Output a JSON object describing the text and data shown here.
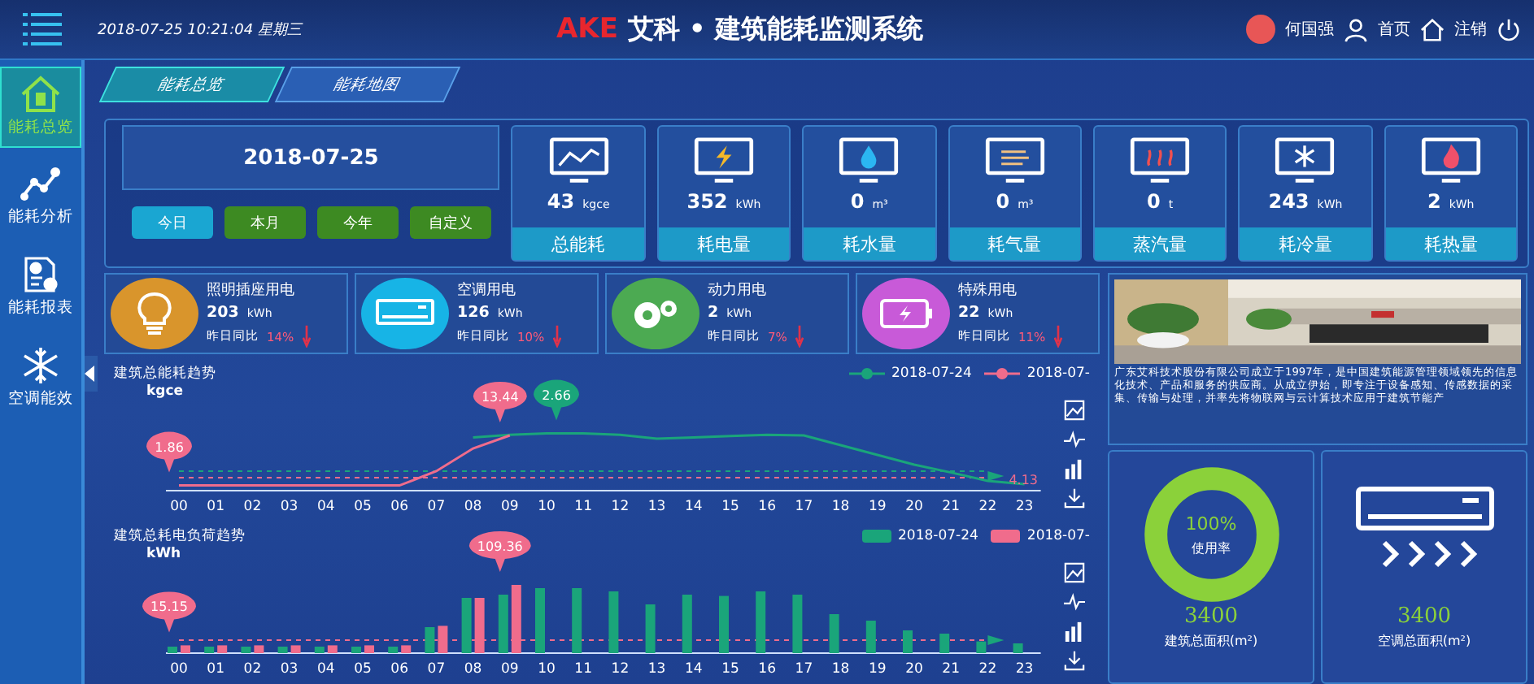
{
  "header": {
    "datetime": "2018-07-25 10:21:04 星期三",
    "logo": "AKE",
    "title": "艾科 • 建筑能耗监测系统",
    "user": "何国强",
    "home": "首页",
    "logout": "注销"
  },
  "tabs": [
    {
      "label": "能耗总览",
      "selected": true
    },
    {
      "label": "能耗地图",
      "selected": false
    }
  ],
  "sidebar": {
    "items": [
      {
        "kind": "house",
        "label": "能耗总览",
        "selected": true
      },
      {
        "kind": "graph",
        "label": "能耗分析",
        "selected": false
      },
      {
        "kind": "report",
        "label": "能耗报表",
        "selected": false
      },
      {
        "kind": "snow",
        "label": "空调能效",
        "selected": false
      }
    ]
  },
  "date_panel": {
    "date": "2018-07-25",
    "periods": [
      {
        "label": "今日",
        "selected": true
      },
      {
        "label": "本月",
        "selected": false
      },
      {
        "label": "今年",
        "selected": false
      },
      {
        "label": "自定义",
        "selected": false
      }
    ]
  },
  "stats": [
    {
      "kind": "trend",
      "value": "43",
      "unit": "kgce",
      "label": "总能耗"
    },
    {
      "kind": "bolt",
      "value": "352",
      "unit": "kWh",
      "label": "耗电量"
    },
    {
      "kind": "drop",
      "value": "0",
      "unit": "m³",
      "label": "耗水量"
    },
    {
      "kind": "wind",
      "value": "0",
      "unit": "m³",
      "label": "耗气量"
    },
    {
      "kind": "heat",
      "value": "0",
      "unit": "t",
      "label": "蒸汽量"
    },
    {
      "kind": "snow",
      "value": "243",
      "unit": "kWh",
      "label": "耗冷量"
    },
    {
      "kind": "flame",
      "value": "2",
      "unit": "kWh",
      "label": "耗热量"
    }
  ],
  "usage": [
    {
      "kind": "bulb",
      "color": "#d9952c",
      "name": "照明插座用电",
      "value": "203",
      "unit": "kWh",
      "compare": "昨日同比",
      "change": "14%"
    },
    {
      "kind": "ac",
      "color": "#17b4e6",
      "name": "空调用电",
      "value": "126",
      "unit": "kWh",
      "compare": "昨日同比",
      "change": "10%"
    },
    {
      "kind": "gears",
      "color": "#4caa52",
      "name": "动力用电",
      "value": "2",
      "unit": "kWh",
      "compare": "昨日同比",
      "change": "7%"
    },
    {
      "kind": "battery",
      "color": "#c85ad8",
      "name": "特殊用电",
      "value": "22",
      "unit": "kWh",
      "compare": "昨日同比",
      "change": "11%"
    }
  ],
  "charts": [
    {
      "kind": "line",
      "title": "建筑总能耗趋势",
      "unit": "kgce",
      "legend": [
        "2018-07-24",
        "2018-07-"
      ],
      "average": "4.13",
      "hours": [
        {
          "label": "00",
          "pin_b": "1.86"
        },
        {
          "label": "01"
        },
        {
          "label": "02"
        },
        {
          "label": "03"
        },
        {
          "label": "04"
        },
        {
          "label": "05"
        },
        {
          "label": "06"
        },
        {
          "label": "07"
        },
        {
          "label": "08"
        },
        {
          "label": "09",
          "pin_b": "13.44"
        },
        {
          "label": "10",
          "pin_a": "2.66"
        },
        {
          "label": "11"
        },
        {
          "label": "12"
        },
        {
          "label": "13"
        },
        {
          "label": "14"
        },
        {
          "label": "15"
        },
        {
          "label": "16"
        },
        {
          "label": "17"
        },
        {
          "label": "18"
        },
        {
          "label": "19"
        },
        {
          "label": "20"
        },
        {
          "label": "21"
        },
        {
          "label": "22"
        },
        {
          "label": "23"
        }
      ]
    },
    {
      "kind": "bar",
      "title": "建筑总耗电负荷趋势",
      "unit": "kWh",
      "legend": [
        "2018-07-24",
        "2018-07-"
      ],
      "hours": [
        {
          "label": "00",
          "pin_b": "15.15"
        },
        {
          "label": "01"
        },
        {
          "label": "02"
        },
        {
          "label": "03"
        },
        {
          "label": "04"
        },
        {
          "label": "05"
        },
        {
          "label": "06"
        },
        {
          "label": "07"
        },
        {
          "label": "08"
        },
        {
          "label": "09",
          "pin_b": "109.36"
        },
        {
          "label": "10"
        },
        {
          "label": "11"
        },
        {
          "label": "12"
        },
        {
          "label": "13"
        },
        {
          "label": "14"
        },
        {
          "label": "15"
        },
        {
          "label": "16"
        },
        {
          "label": "17"
        },
        {
          "label": "18"
        },
        {
          "label": "19"
        },
        {
          "label": "20"
        },
        {
          "label": "21"
        },
        {
          "label": "22"
        },
        {
          "label": "23"
        }
      ]
    }
  ],
  "company": {
    "text": "广东艾科技术股份有限公司成立于1997年，是中国建筑能源管理领域领先的信息化技术、产品和服务的供应商。从成立伊始，即专注于设备感知、传感数据的采集、传输与处理，并率先将物联网与云计算技术应用于建筑节能产"
  },
  "areas": [
    {
      "kind": "gauge",
      "percent": "100%",
      "caption": "使用率",
      "value": "3400",
      "label": "建筑总面积(m²)"
    },
    {
      "kind": "ac",
      "value": "3400",
      "label": "空调总面积(m²)"
    }
  ]
}
